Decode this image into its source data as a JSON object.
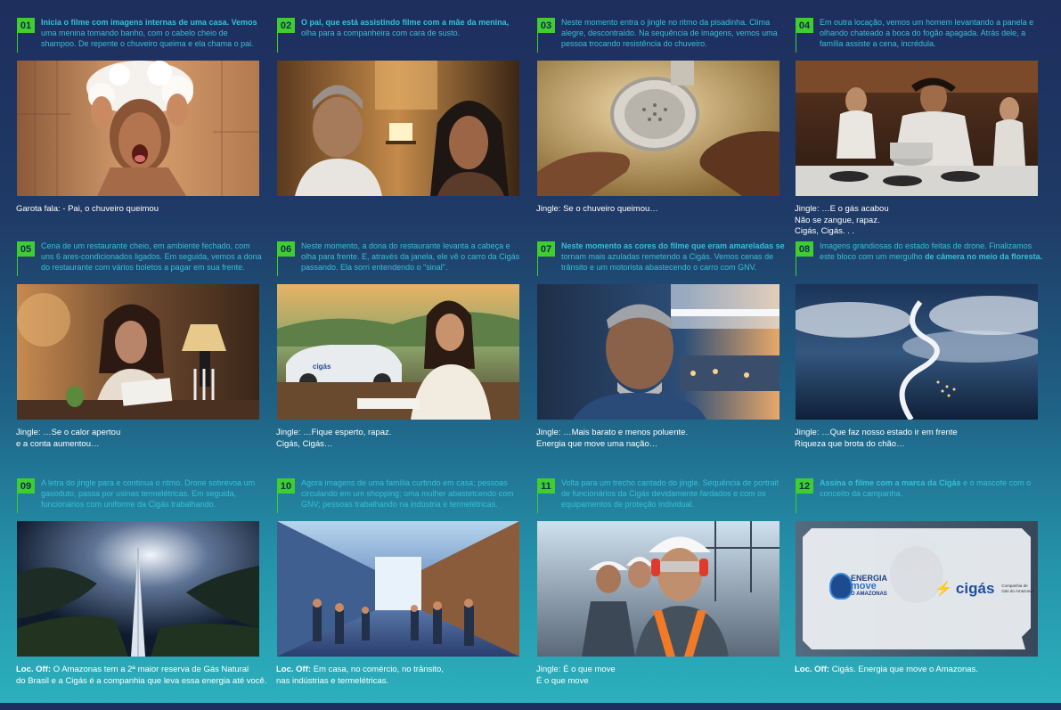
{
  "panels": [
    {
      "num": "01",
      "desc_bold": "Inicia o filme com imagens internas de uma casa. Vemos",
      "desc": " uma menina tomando banho, com o cabelo cheio de shampoo. De repente o chuveiro queima e ela chama o pai.",
      "cap_bold": "",
      "cap": "Garota fala:  - Pai, o chuveiro queimou",
      "image": "girl-shower-foam"
    },
    {
      "num": "02",
      "desc_bold": "O pai, que está assistindo filme com a mãe da menina,",
      "desc": " olha para a companheira com cara de susto.",
      "cap_bold": "",
      "cap": "",
      "image": "couple-living-room"
    },
    {
      "num": "03",
      "desc_bold": "",
      "desc": "Neste momento entra o jingle no ritmo da pisadinha. Clima alegre, descontraído. Na sequência de imagens, vemos uma pessoa trocando resistência do chuveiro.",
      "cap_bold": "",
      "cap": "Jingle:  Se o chuveiro queimou…",
      "image": "hands-showerhead"
    },
    {
      "num": "04",
      "desc_bold": "",
      "desc": "Em outra locação, vemos um homem levantando a panela e olhando chateado a boca do fogão apagada. Atrás dele, a família assiste a cena, incrédula.",
      "cap_bold": "",
      "cap": "Jingle: …E o gás acabou\nNão se zangue, rapaz.\nCigás, Cigás. . .",
      "image": "man-stove-pot"
    },
    {
      "num": "05",
      "desc_bold": "",
      "desc": "Cena de um restaurante cheio, em ambiente fechado, com uns 6 ares-condicionados ligados. Em seguida, vemos  a dona do restaurante com vários boletos a pagar em sua frente.",
      "cap_bold": "",
      "cap": "Jingle: …Se o calor apertou\ne a conta aumentou…",
      "image": "woman-bills-restaurant"
    },
    {
      "num": "06",
      "desc_bold": "",
      "desc": "Neste momento, a dona do restaurante levanta a cabeça e olha para frente. E, através da janela, ele vê o carro da Cigás passando. Ela sorri entendendo o \"sinal\".",
      "cap_bold": "",
      "cap": "Jingle: …Fique esperto, rapaz.\nCigás, Cigás…",
      "image": "woman-window-car"
    },
    {
      "num": "07",
      "desc_bold": "Neste momento as cores do filme que eram amareladas se",
      "desc": " tornam mais azuladas remetendo a Cigás. Vemos cenas de trânsito e um motorista abastecendo o carro com GNV.",
      "cap_bold": "",
      "cap": "Jingle: …Mais barato e menos poluente.\nEnergia que move uma nação…",
      "image": "driver-gas-station"
    },
    {
      "num": "08",
      "desc_bold": "",
      "desc": "Imagens grandiosas do estado feitas de drone. Finalizamos este bloco com um mergulho ",
      "desc_tail_bold": "de câmera no meio da floresta.",
      "cap_bold": "",
      "cap": "Jingle: …Que faz nosso estado ir em frente\nRiqueza que brota do chão…",
      "image": "river-aerial"
    },
    {
      "num": "09",
      "desc_bold": "",
      "desc": "A letra do jingle para e continua o ritmo. Drone sobrevoa um gasoduto, passa por usinas termelétricas. Em seguida, funcionários com uniforme da Cigás trabalhando.",
      "cap_bold": "Loc. Off:",
      "cap": " O Amazonas tem a 2ª maior reserva de Gás Natural\ndo Brasil e a Cigás é a companhia que leva essa energia até você.",
      "image": "pipeline-forest"
    },
    {
      "num": "10",
      "desc_bold": "",
      "desc": "Agora imagens de uma família curtindo em casa;  pessoas circulando em um shopping; uma mulher abastetcendo com GNV; pessoas trabalhando na indústria e termelétricas.",
      "cap_bold": "Loc. Off:",
      "cap": "  Em casa, no comércio, no trânsito,\nnas indústrias e termelétricas.",
      "image": "shopping-mall"
    },
    {
      "num": "11",
      "desc_bold": "",
      "desc": "Volta para um trecho cantado do jingle. Sequência de portrait de funcionários da Cigás devidamente fardados e com os equipamentos de proteção individual.",
      "cap_bold": "",
      "cap": "Jingle: É o que move\nÉ o que move",
      "image": "workers-helmets"
    },
    {
      "num": "12",
      "desc_bold": "Assina o filme com a marca da Cigás",
      "desc": "\ne o mascote com o conceito da campanha.",
      "cap_bold": "Loc. Off:",
      "cap": " Cigás. Energia que move o Amazonas.",
      "image": "brand-endcard",
      "brand": {
        "tag_line1": "ENERGIA",
        "tag_line2": "move",
        "tag_line3": "O AMAZONAS",
        "logo": "cigás",
        "logo_sub1": "Companhia de",
        "logo_sub2": "Gás do Amazonas"
      }
    }
  ],
  "colors": {
    "accent_green": "#3ecf2e",
    "desc_cyan": "#35c0d8",
    "caption": "#ffffff"
  }
}
